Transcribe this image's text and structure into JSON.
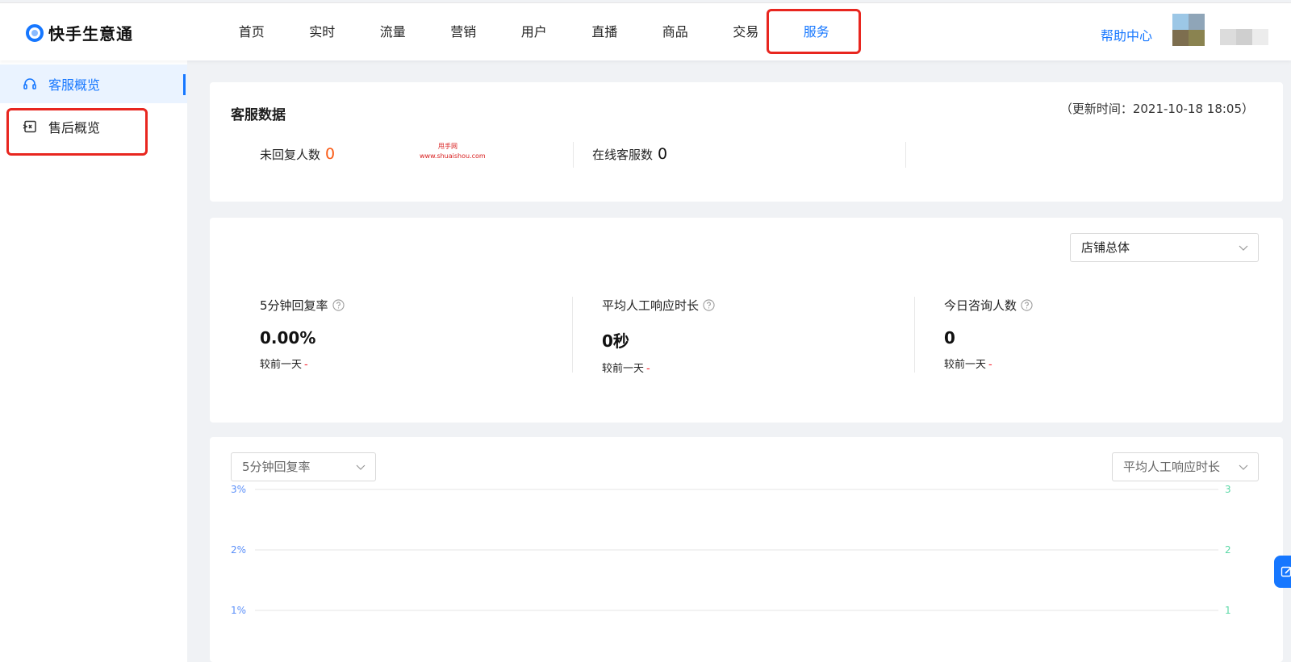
{
  "app": {
    "logo_text": "快手生意通"
  },
  "nav": {
    "items": [
      "首页",
      "实时",
      "流量",
      "营销",
      "用户",
      "直播",
      "商品",
      "交易",
      "服务"
    ],
    "active_index": 8
  },
  "header": {
    "help_label": "帮助中心"
  },
  "sidebar": {
    "items": [
      {
        "label": "客服概览",
        "icon": "headset-icon",
        "active": true
      },
      {
        "label": "售后概览",
        "icon": "aftersale-icon",
        "active": false
      }
    ]
  },
  "service_data": {
    "title": "客服数据",
    "update_time": "（更新时间：2021-10-18 18:05）",
    "unreplied_label": "未回复人数",
    "unreplied_value": "0",
    "online_label": "在线客服数",
    "online_value": "0",
    "watermark_line1": "甩手网",
    "watermark_line2": "www.shuaishou.com"
  },
  "metrics_panel": {
    "scope_select": "店铺总体",
    "compare_label": "较前一天",
    "compare_value": "-",
    "metrics": [
      {
        "label": "5分钟回复率",
        "value": "0.00%"
      },
      {
        "label": "平均人工响应时长",
        "value": "0秒"
      },
      {
        "label": "今日咨询人数",
        "value": "0"
      }
    ]
  },
  "chart_panel": {
    "left_select": "5分钟回复率",
    "right_select": "平均人工响应时长"
  },
  "chart_data": {
    "type": "line",
    "series": [],
    "y_left_ticks": [
      "3%",
      "2%",
      "1%"
    ],
    "y_right_ticks": [
      "3",
      "2",
      "1"
    ],
    "y_left_range": [
      0,
      3
    ],
    "y_right_range": [
      0,
      3
    ],
    "grid": true
  },
  "colors": {
    "accent": "#1677ff",
    "highlight_box": "#e8261f",
    "orange_number": "#fa5a14",
    "left_axis": "#5b8ff9",
    "right_axis": "#5ad8a6",
    "grid_line": "#e5e5e5"
  }
}
